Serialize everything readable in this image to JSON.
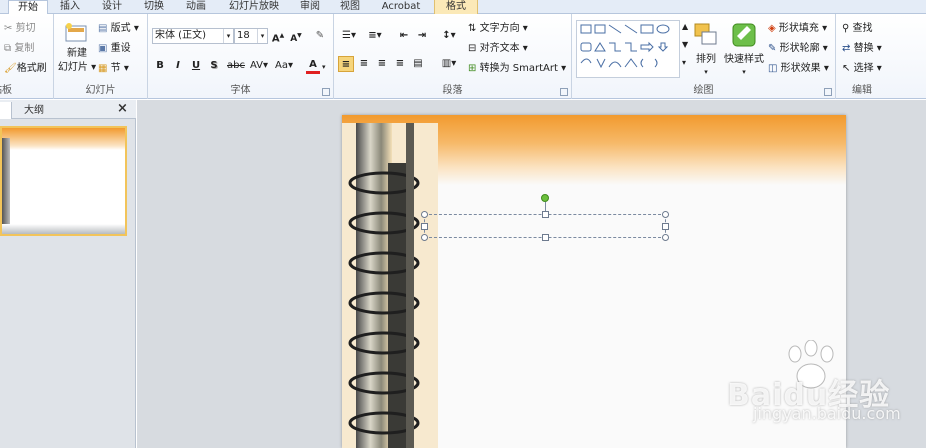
{
  "tabs": [
    {
      "label": "开始",
      "active": true
    },
    {
      "label": "插入"
    },
    {
      "label": "设计"
    },
    {
      "label": "切换"
    },
    {
      "label": "动画"
    },
    {
      "label": "幻灯片放映"
    },
    {
      "label": "审阅"
    },
    {
      "label": "视图"
    },
    {
      "label": "Acrobat"
    },
    {
      "label": "格式",
      "context": true
    }
  ],
  "clipboard": {
    "cut": "剪切",
    "copy": "复制",
    "format_painter": "格式刷",
    "group_label": "剪贴板"
  },
  "slides": {
    "new_slide_line1": "新建",
    "new_slide_line2": "幻灯片",
    "layout": "版式",
    "reset": "重设",
    "section": "节",
    "group_label": "幻灯片"
  },
  "font": {
    "name": "宋体 (正文)",
    "size": "18",
    "group_label": "字体"
  },
  "paragraph": {
    "text_direction": "文字方向",
    "align_text": "对齐文本",
    "smartart": "转换为 SmartArt",
    "group_label": "段落"
  },
  "drawing": {
    "arrange": "排列",
    "quick_styles": "快速样式",
    "shape_fill": "形状填充",
    "shape_outline": "形状轮廓",
    "shape_effects": "形状效果",
    "group_label": "绘图"
  },
  "editing": {
    "find": "查找",
    "replace": "替换",
    "select": "选择",
    "group_label": "编辑"
  },
  "pane": {
    "outline_tab": "大纲",
    "close": "×"
  },
  "watermark": {
    "brand": "Baidu经验",
    "url": "jingyan.baidu.com"
  },
  "colors": {
    "accent": "#e46c0a",
    "selection": "#f2c45a",
    "rotate_handle": "#6bbf3c"
  }
}
